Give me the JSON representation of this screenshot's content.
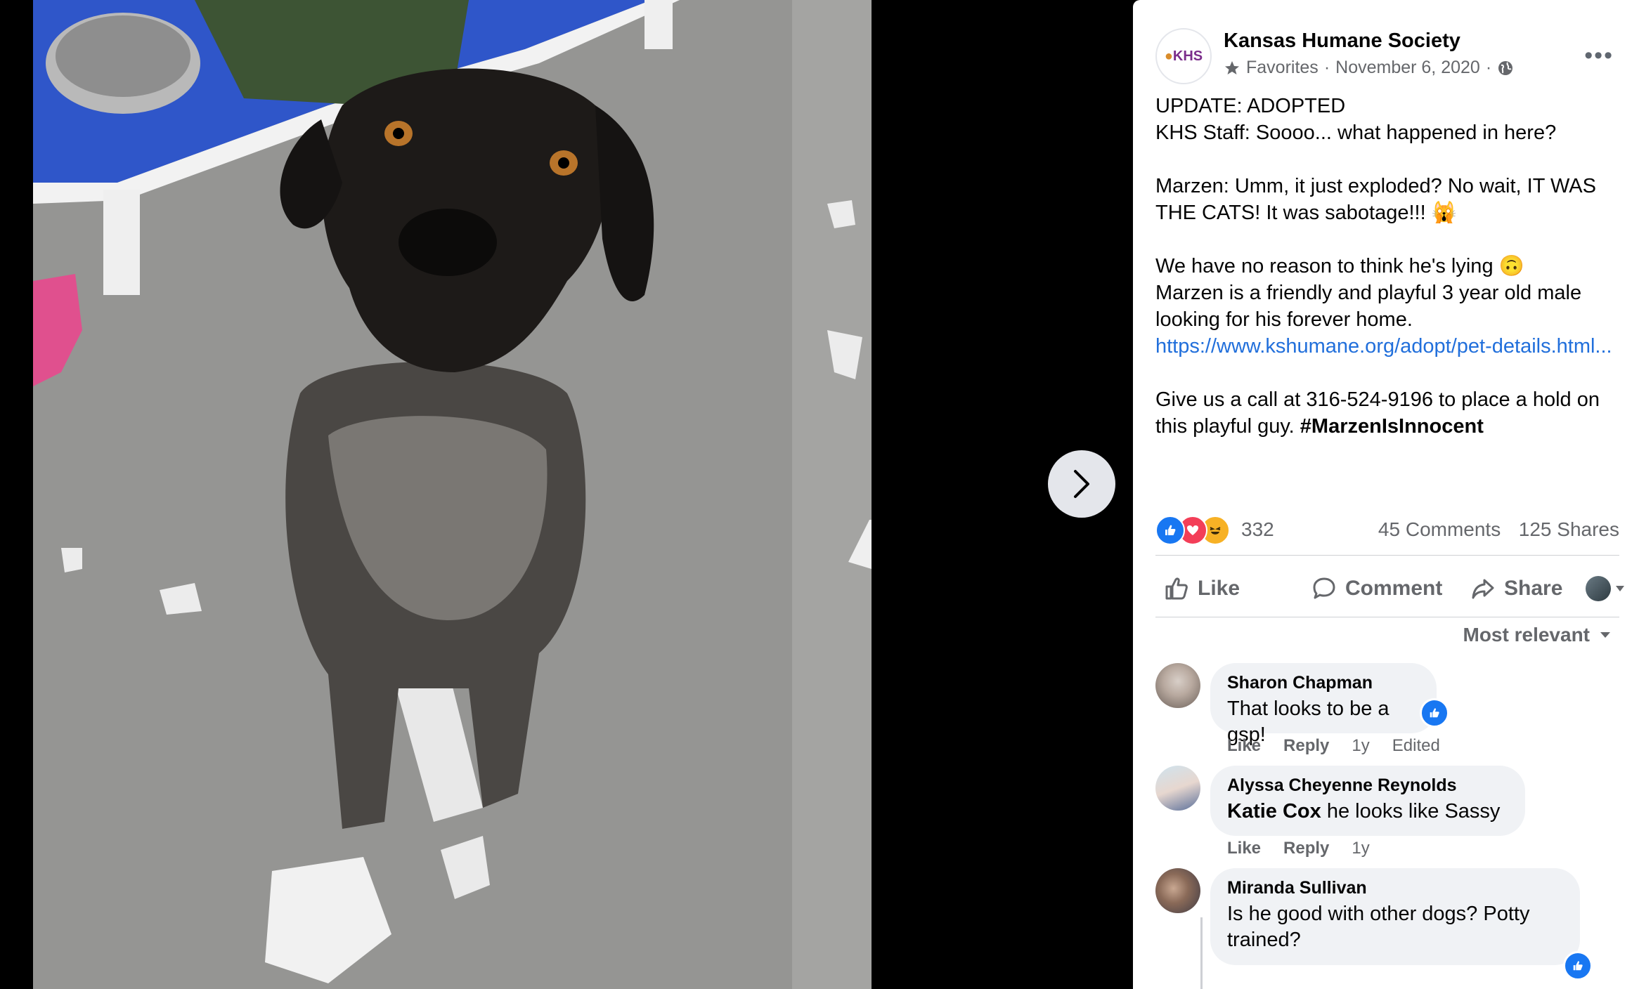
{
  "viewer": {
    "next_button_icon": "chevron-right-icon"
  },
  "post": {
    "page_name": "Kansas Humane Society",
    "avatar_text": "KHS",
    "audience": "Favorites",
    "date": "November 6, 2020",
    "separator": "·",
    "privacy_icon": "globe-icon",
    "more_icon": "more-options-icon",
    "lines": {
      "l1": "UPDATE: ADOPTED",
      "l2": "KHS Staff: Soooo... what happened in here?",
      "l3": "Marzen: Umm, it just exploded? No wait, IT WAS THE CATS! It was sabotage!!! 🙀",
      "l4": "We have no reason to think he's lying 🙃",
      "l5": "Marzen is a friendly and playful 3 year old male looking for his forever home.",
      "link": "https://www.kshumane.org/adopt/pet-details.html...",
      "l6": "Give us a call at 316-524-9196 to place a hold on this playful guy.",
      "hashtag": "#MarzenIsInnocent"
    },
    "reaction_count": "332",
    "comments_count": "45 Comments",
    "shares_count": "125 Shares",
    "accent": "#1877f2"
  },
  "actions": {
    "like": "Like",
    "comment": "Comment",
    "share": "Share"
  },
  "sort_label": "Most relevant",
  "comments": [
    {
      "author": "Sharon Chapman",
      "text": "That looks to be a gsp!",
      "like": "Like",
      "reply": "Reply",
      "time": "1y",
      "edited": "Edited"
    },
    {
      "author": "Alyssa Cheyenne Reynolds",
      "mention": "Katie Cox",
      "text": " he looks like Sassy",
      "like": "Like",
      "reply": "Reply",
      "time": "1y"
    },
    {
      "author": "Miranda Sullivan",
      "text": "Is he good with other dogs? Potty trained?"
    }
  ]
}
